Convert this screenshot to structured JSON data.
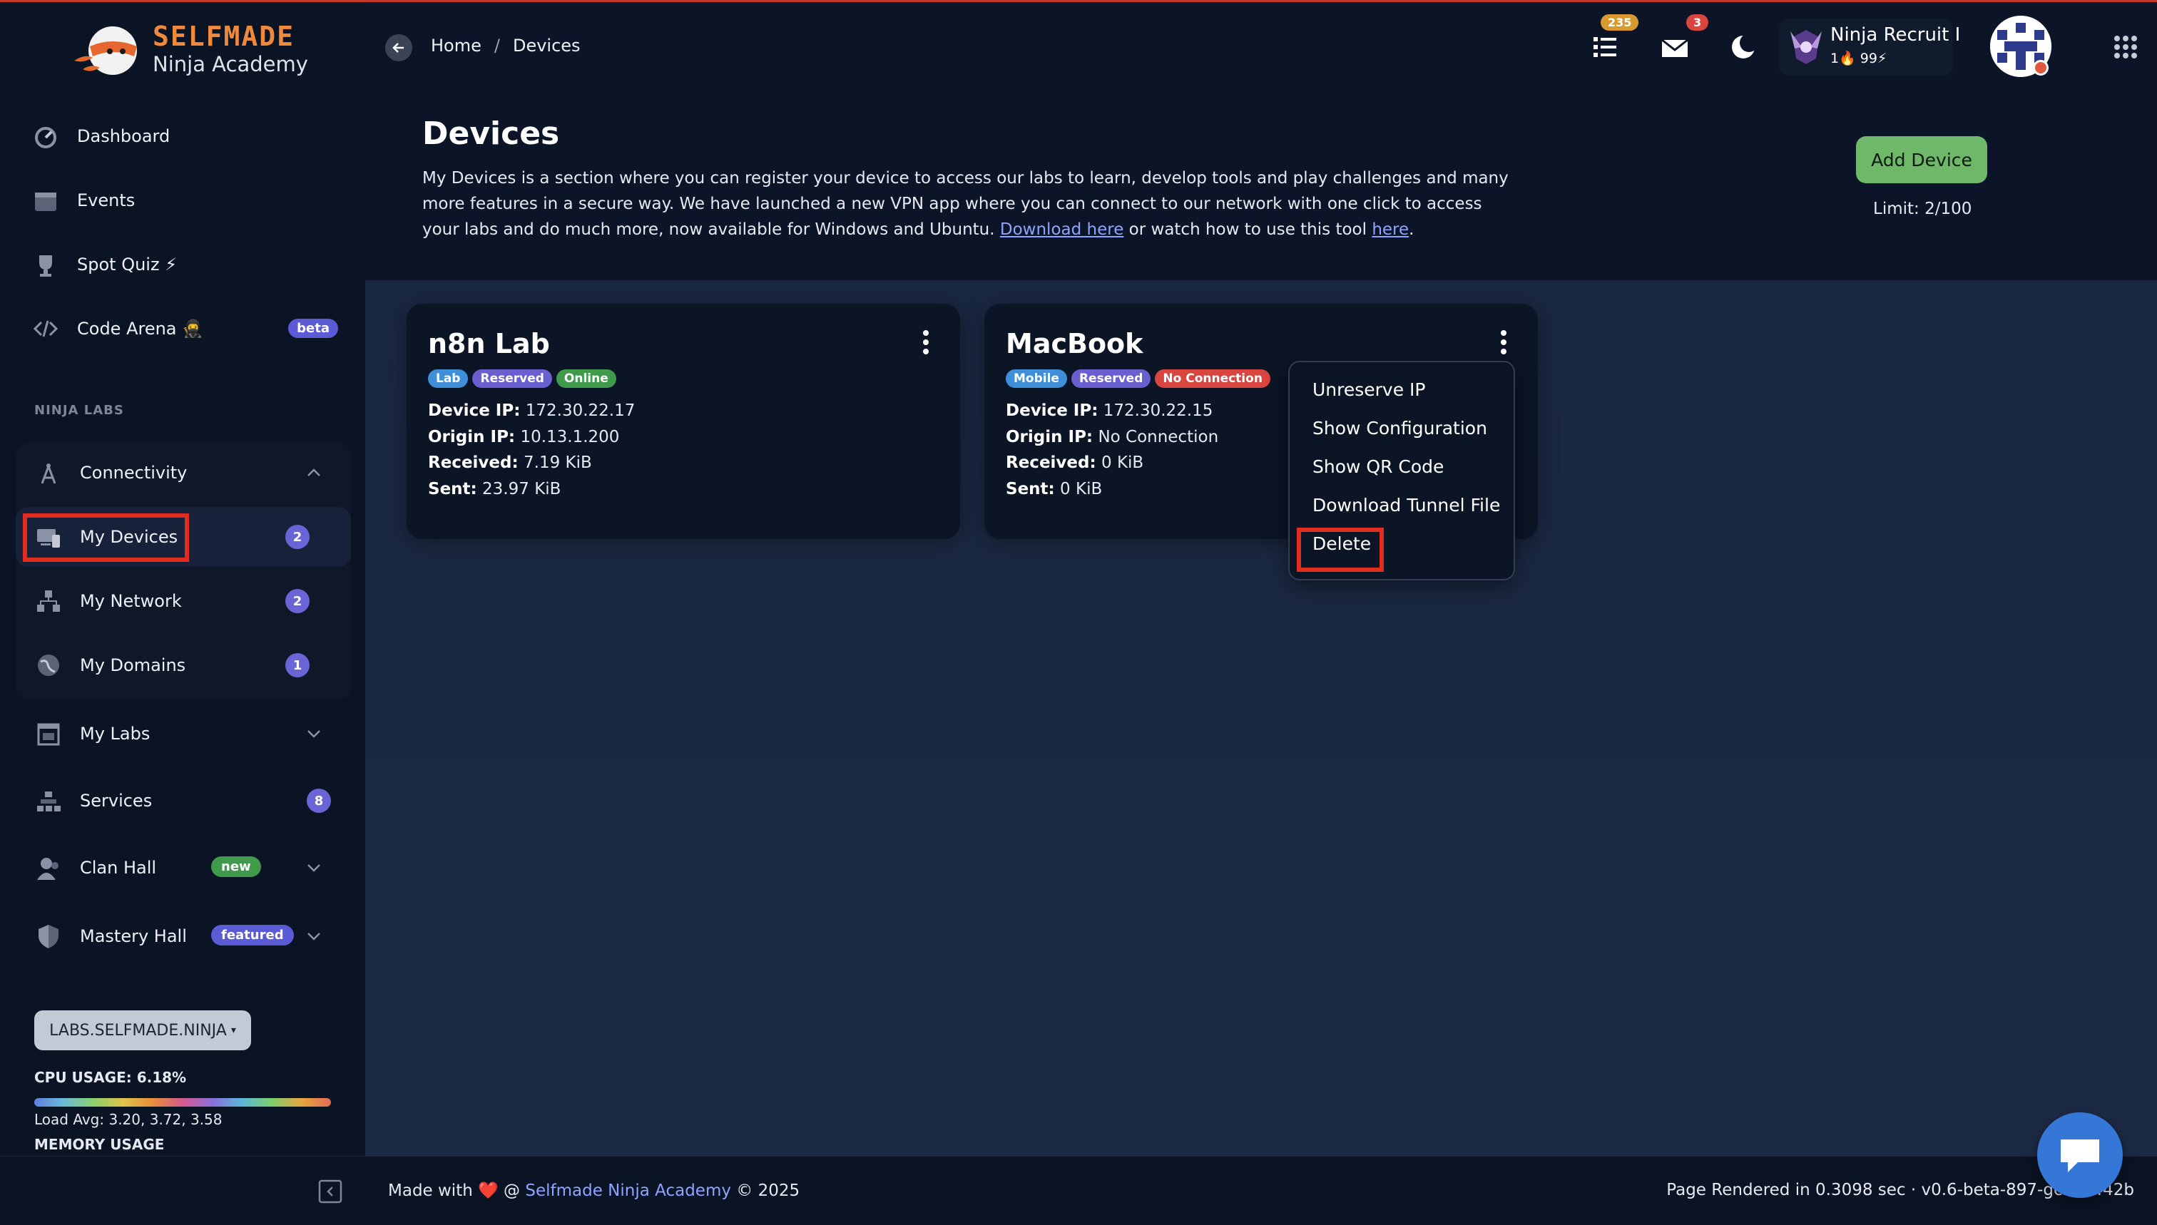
{
  "brand": {
    "title": "SELFMADE",
    "subtitle": "Ninja Academy"
  },
  "breadcrumb": {
    "home": "Home",
    "separator": "/",
    "current": "Devices"
  },
  "topbar": {
    "tasks_count": "235",
    "messages_count": "3",
    "user_name": "Ninja Recruit I",
    "user_stats": "1🔥 99⚡"
  },
  "sidebar": {
    "items": [
      {
        "label": "Dashboard",
        "icon": "dashboard-icon"
      },
      {
        "label": "Events",
        "icon": "calendar-icon"
      },
      {
        "label": "Spot Quiz ⚡",
        "icon": "trophy-icon"
      },
      {
        "label": "Code Arena 🥷",
        "icon": "code-icon",
        "badge": "beta"
      }
    ],
    "section_title": "NINJA LABS",
    "labs": {
      "group_label": "Connectivity",
      "children": [
        {
          "label": "My Devices",
          "count": "2"
        },
        {
          "label": "My Network",
          "count": "2"
        },
        {
          "label": "My Domains",
          "count": "1"
        }
      ]
    },
    "more": [
      {
        "label": "My Labs"
      },
      {
        "label": "Services",
        "count": "8"
      },
      {
        "label": "Clan Hall",
        "badge": "new"
      },
      {
        "label": "Mastery Hall",
        "badge": "featured"
      }
    ],
    "server_button": "LABS.SELFMADE.NINJA",
    "cpu_usage": "CPU USAGE: 6.18%",
    "load_avg": "Load Avg: 3.20, 3.72, 3.58",
    "memory_usage": "MEMORY USAGE"
  },
  "header": {
    "title": "Devices",
    "desc_1": "My Devices is a section where you can register your device to access our labs to learn, develop tools and play challenges and many more features in a secure way. We have launched a new VPN app where you can connect to our network with one click to access your labs and do much more, now available for Windows and Ubuntu. ",
    "desc_link_1": "Download here",
    "desc_2": " or watch how to use this tool ",
    "desc_link_2": "here",
    "desc_3": ".",
    "add_button": "Add Device",
    "limit": "Limit: 2/100"
  },
  "devices": [
    {
      "name": "n8n Lab",
      "tags": [
        "Lab",
        "Reserved",
        "Online"
      ],
      "device_ip_label": "Device IP:",
      "device_ip": "172.30.22.17",
      "origin_ip_label": "Origin IP:",
      "origin_ip": "10.13.1.200",
      "received_label": "Received:",
      "received": "7.19 KiB",
      "sent_label": "Sent:",
      "sent": "23.97 KiB"
    },
    {
      "name": "MacBook",
      "tags": [
        "Mobile",
        "Reserved",
        "No Connection"
      ],
      "device_ip_label": "Device IP:",
      "device_ip": "172.30.22.15",
      "origin_ip_label": "Origin IP:",
      "origin_ip": "No Connection",
      "received_label": "Received:",
      "received": "0 KiB",
      "sent_label": "Sent:",
      "sent": "0 KiB"
    }
  ],
  "context_menu": [
    "Unreserve IP",
    "Show Configuration",
    "Show QR Code",
    "Download Tunnel File",
    "Delete"
  ],
  "footer": {
    "made_with": "Made with ❤️ @ ",
    "link": "Selfmade Ninja Academy",
    "year": " © 2025",
    "render_info": "Page Rendered in 0.3098 sec · v0.6-beta-897-gc2c5442b"
  },
  "colors": {
    "accent_orange": "#ef8a3c",
    "tag_blue": "#3e8fd8",
    "tag_purple": "#6a5fcf",
    "tag_green": "#3f9a4c",
    "tag_red": "#d9453f",
    "add_button": "#6fb86a"
  }
}
